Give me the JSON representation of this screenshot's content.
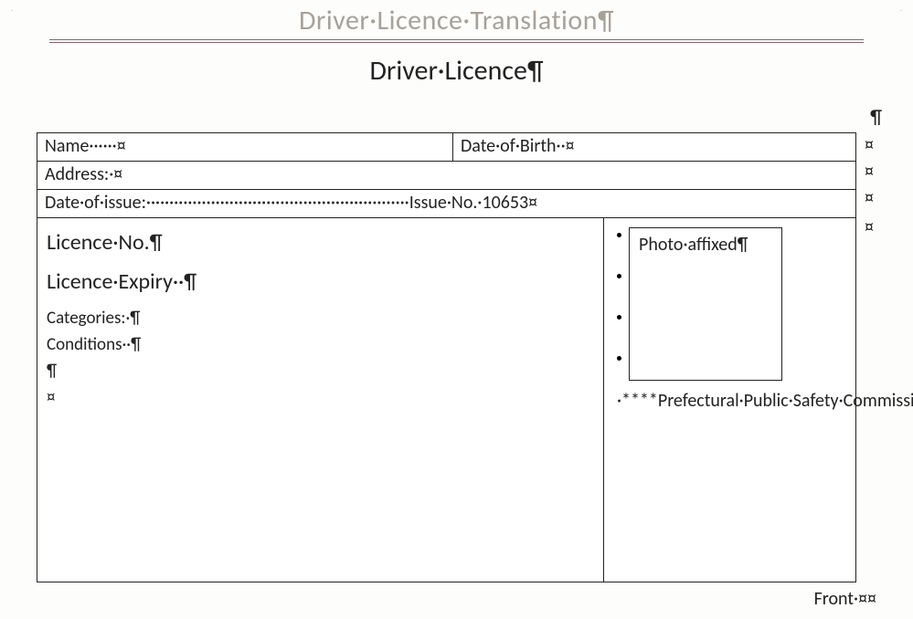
{
  "marks": {
    "pilcrow": "¶",
    "cell_end": "¤",
    "mid_dot": "·",
    "corner": "˙"
  },
  "header": {
    "doc_title": "Driver·Licence·Translation¶",
    "subtitle": "Driver·Licence¶"
  },
  "table": {
    "name_label": "Name······¤",
    "dob_label": "Date·of·Birth··¤",
    "address_label": "Address:·¤",
    "issue_line": "Date·of·issue:·························································Issue·No.·10653¤",
    "licence_no": "Licence·No.¶",
    "licence_expiry": "Licence·Expiry··¶",
    "categories": "Categories:·¶",
    "conditions": "Conditions··¶",
    "extra_pilcrow": "¶",
    "extra_cell": "¤",
    "photo_label": "Photo·affixed¶",
    "commission": "·****Prefectural·Public·Safety·Commission·¤"
  },
  "footer": {
    "front": "Front·¤¤"
  }
}
